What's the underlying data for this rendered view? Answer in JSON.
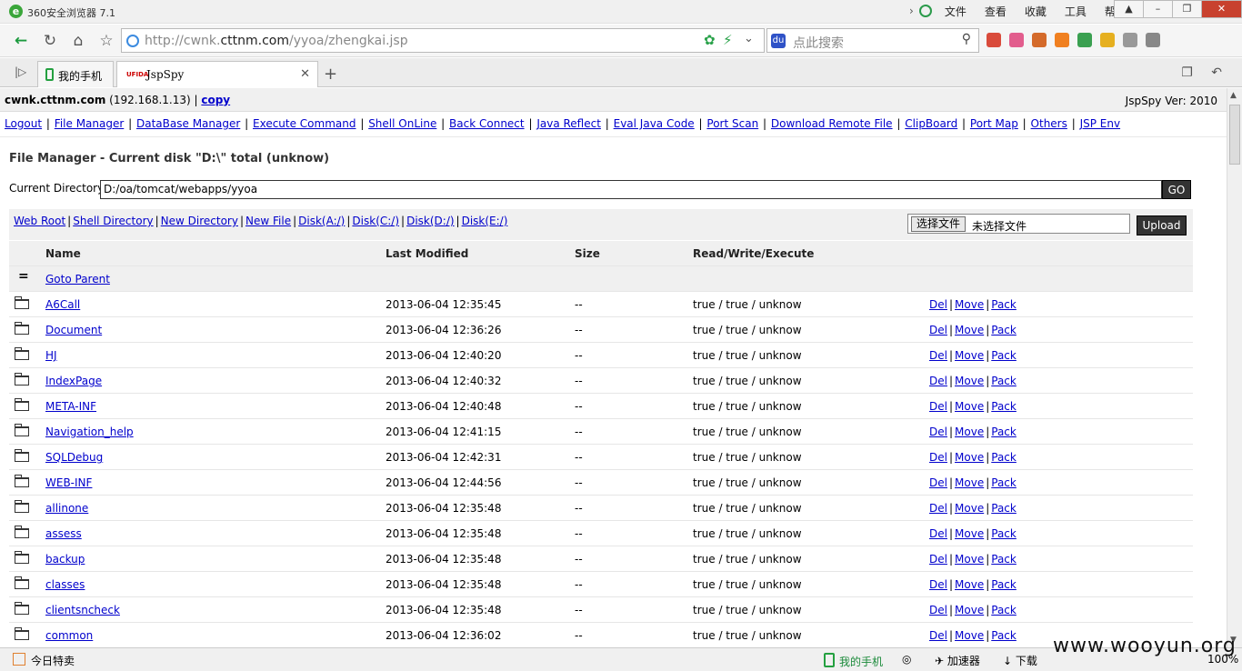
{
  "browser": {
    "app_title": "360安全浏览器 7.1",
    "menu": [
      "文件",
      "查看",
      "收藏",
      "工具",
      "帮助"
    ],
    "url_host": "http://cwnk.",
    "url_domain": "cttnm.com",
    "url_path": "/yyoa/zhengkai.jsp",
    "search_placeholder": "点此搜索",
    "tabs": [
      {
        "label": "我的手机"
      },
      {
        "label": "JspSpy",
        "logo": "UFIDA"
      }
    ]
  },
  "host": {
    "name": "cwnk.cttnm.com",
    "ip": " (192.168.1.13) | ",
    "copy_label": "copy",
    "version": "JspSpy Ver: 2010"
  },
  "nav": [
    "Logout",
    "File Manager",
    "DataBase Manager",
    "Execute Command",
    "Shell OnLine",
    "Back Connect",
    "Java Reflect",
    "Eval Java Code",
    "Port Scan",
    "Download Remote File",
    "ClipBoard",
    "Port Map",
    "Others",
    "JSP Env"
  ],
  "file_manager": {
    "title": "File Manager - Current disk \"D:\\\" total (unknow)",
    "current_dir_label": "Current Directory",
    "current_dir_value": "D:/oa/tomcat/webapps/yyoa",
    "go_label": "GO",
    "dir_links": [
      "Web Root",
      "Shell Directory",
      "New Directory",
      "New File",
      "Disk(A:/)",
      "Disk(C:/)",
      "Disk(D:/)",
      "Disk(E:/)"
    ],
    "choose_file_label": "选择文件",
    "no_file_label": "未选择文件",
    "upload_label": "Upload",
    "columns": {
      "name": "Name",
      "modified": "Last Modified",
      "size": "Size",
      "rwx": "Read/Write/Execute"
    },
    "goto_parent": "Goto Parent",
    "parent_icon": "=",
    "actions": [
      "Del",
      "Move",
      "Pack"
    ],
    "rows": [
      {
        "name": "A6Call",
        "modified": "2013-06-04 12:35:45",
        "size": "--",
        "rwx": "true / true / unknow"
      },
      {
        "name": "Document",
        "modified": "2013-06-04 12:36:26",
        "size": "--",
        "rwx": "true / true / unknow"
      },
      {
        "name": "HJ",
        "modified": "2013-06-04 12:40:20",
        "size": "--",
        "rwx": "true / true / unknow"
      },
      {
        "name": "IndexPage",
        "modified": "2013-06-04 12:40:32",
        "size": "--",
        "rwx": "true / true / unknow"
      },
      {
        "name": "META-INF",
        "modified": "2013-06-04 12:40:48",
        "size": "--",
        "rwx": "true / true / unknow"
      },
      {
        "name": "Navigation_help",
        "modified": "2013-06-04 12:41:15",
        "size": "--",
        "rwx": "true / true / unknow"
      },
      {
        "name": "SQLDebug",
        "modified": "2013-06-04 12:42:31",
        "size": "--",
        "rwx": "true / true / unknow"
      },
      {
        "name": "WEB-INF",
        "modified": "2013-06-04 12:44:56",
        "size": "--",
        "rwx": "true / true / unknow"
      },
      {
        "name": "allinone",
        "modified": "2013-06-04 12:35:48",
        "size": "--",
        "rwx": "true / true / unknow"
      },
      {
        "name": "assess",
        "modified": "2013-06-04 12:35:48",
        "size": "--",
        "rwx": "true / true / unknow"
      },
      {
        "name": "backup",
        "modified": "2013-06-04 12:35:48",
        "size": "--",
        "rwx": "true / true / unknow"
      },
      {
        "name": "classes",
        "modified": "2013-06-04 12:35:48",
        "size": "--",
        "rwx": "true / true / unknow"
      },
      {
        "name": "clientsncheck",
        "modified": "2013-06-04 12:35:48",
        "size": "--",
        "rwx": "true / true / unknow"
      },
      {
        "name": "common",
        "modified": "2013-06-04 12:36:02",
        "size": "--",
        "rwx": "true / true / unknow"
      }
    ]
  },
  "status": {
    "deal": "今日特卖",
    "phone": "我的手机",
    "accelerator": "加速器",
    "download": "下载",
    "zoom": "100%"
  },
  "watermark": "www.wooyun.org"
}
